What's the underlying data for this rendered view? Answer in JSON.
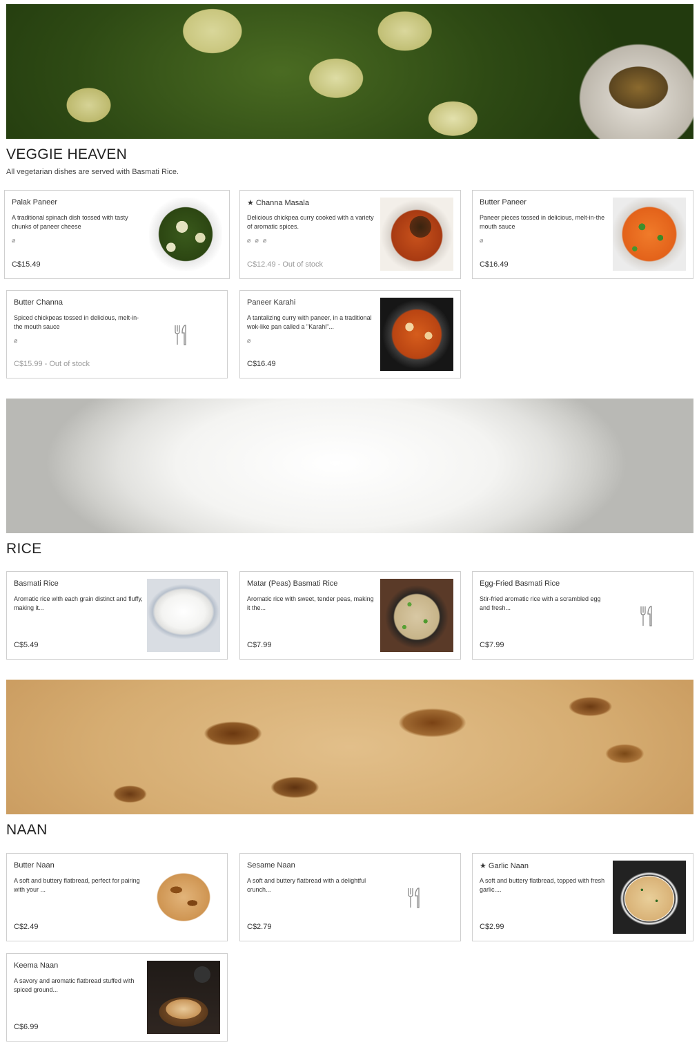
{
  "sections": {
    "veggie": {
      "title": "VEGGIE HEAVEN",
      "description": "All vegetarian dishes are served with Basmati Rice.",
      "banner_image": "palak-paneer-banner",
      "items": [
        {
          "name": "Palak Paneer",
          "description": "A traditional spinach dish tossed with tasty chunks of paneer cheese",
          "tags": [
            "leaf-icon"
          ],
          "price": "C$15.49",
          "image": "palak-paneer-photo"
        },
        {
          "name": "★ Channa Masala",
          "description": "Delicious chickpea curry cooked with a variety of aromatic spices.",
          "tags": [
            "leaf-icon",
            "leaf-icon",
            "leaf-icon"
          ],
          "price": "C$12.49 - Out of stock",
          "image": "channa-masala-photo"
        },
        {
          "name": "Butter Paneer",
          "description": "Paneer pieces tossed in delicious, melt-in-the mouth sauce",
          "tags": [
            "leaf-icon"
          ],
          "price": "C$16.49",
          "image": "butter-paneer-photo"
        },
        {
          "name": "Butter Channa",
          "description": "Spiced chickpeas tossed in delicious, melt-in-the mouth sauce",
          "tags": [
            "leaf-icon"
          ],
          "price": "C$15.99 - Out of stock",
          "image": "utensils-icon"
        },
        {
          "name": "Paneer Karahi",
          "description": "A tantalizing curry with paneer, in a traditional wok-like pan called a \"Karahi\"...",
          "tags": [
            "leaf-icon"
          ],
          "price": "C$16.49",
          "image": "paneer-karahi-photo"
        }
      ]
    },
    "rice": {
      "title": "RICE",
      "banner_image": "rice-bowl-banner",
      "items": [
        {
          "name": "Basmati Rice",
          "description": "Aromatic rice with each grain distinct and fluffy, making it...",
          "price": "C$5.49",
          "image": "basmati-rice-photo"
        },
        {
          "name": "Matar (Peas) Basmati Rice",
          "description": "Aromatic rice with sweet, tender peas, making it the...",
          "price": "C$7.99",
          "image": "matar-rice-photo"
        },
        {
          "name": "Egg-Fried Basmati Rice",
          "description": "Stir-fried aromatic rice with a scrambled egg and fresh...",
          "price": "C$7.99",
          "image": "utensils-icon"
        }
      ]
    },
    "naan": {
      "title": "NAAN",
      "banner_image": "naan-banner",
      "items": [
        {
          "name": "Butter Naan",
          "description": "A soft and buttery flatbread, perfect for pairing with your ...",
          "price": "C$2.49",
          "image": "butter-naan-photo"
        },
        {
          "name": "Sesame Naan",
          "description": "A soft and buttery flatbread with a delightful crunch...",
          "price": "C$2.79",
          "image": "utensils-icon"
        },
        {
          "name": "★ Garlic Naan",
          "description": "A soft and buttery flatbread,  topped with fresh garlic....",
          "price": "C$2.99",
          "image": "garlic-naan-photo"
        },
        {
          "name": "Keema Naan",
          "description": "A savory and aromatic flatbread stuffed with spiced ground...",
          "price": "C$6.99",
          "image": "keema-naan-photo"
        }
      ]
    }
  },
  "colors": {
    "card_border": "#cfcfcf",
    "text": "#333333",
    "out_of_stock_text": "#999999"
  }
}
